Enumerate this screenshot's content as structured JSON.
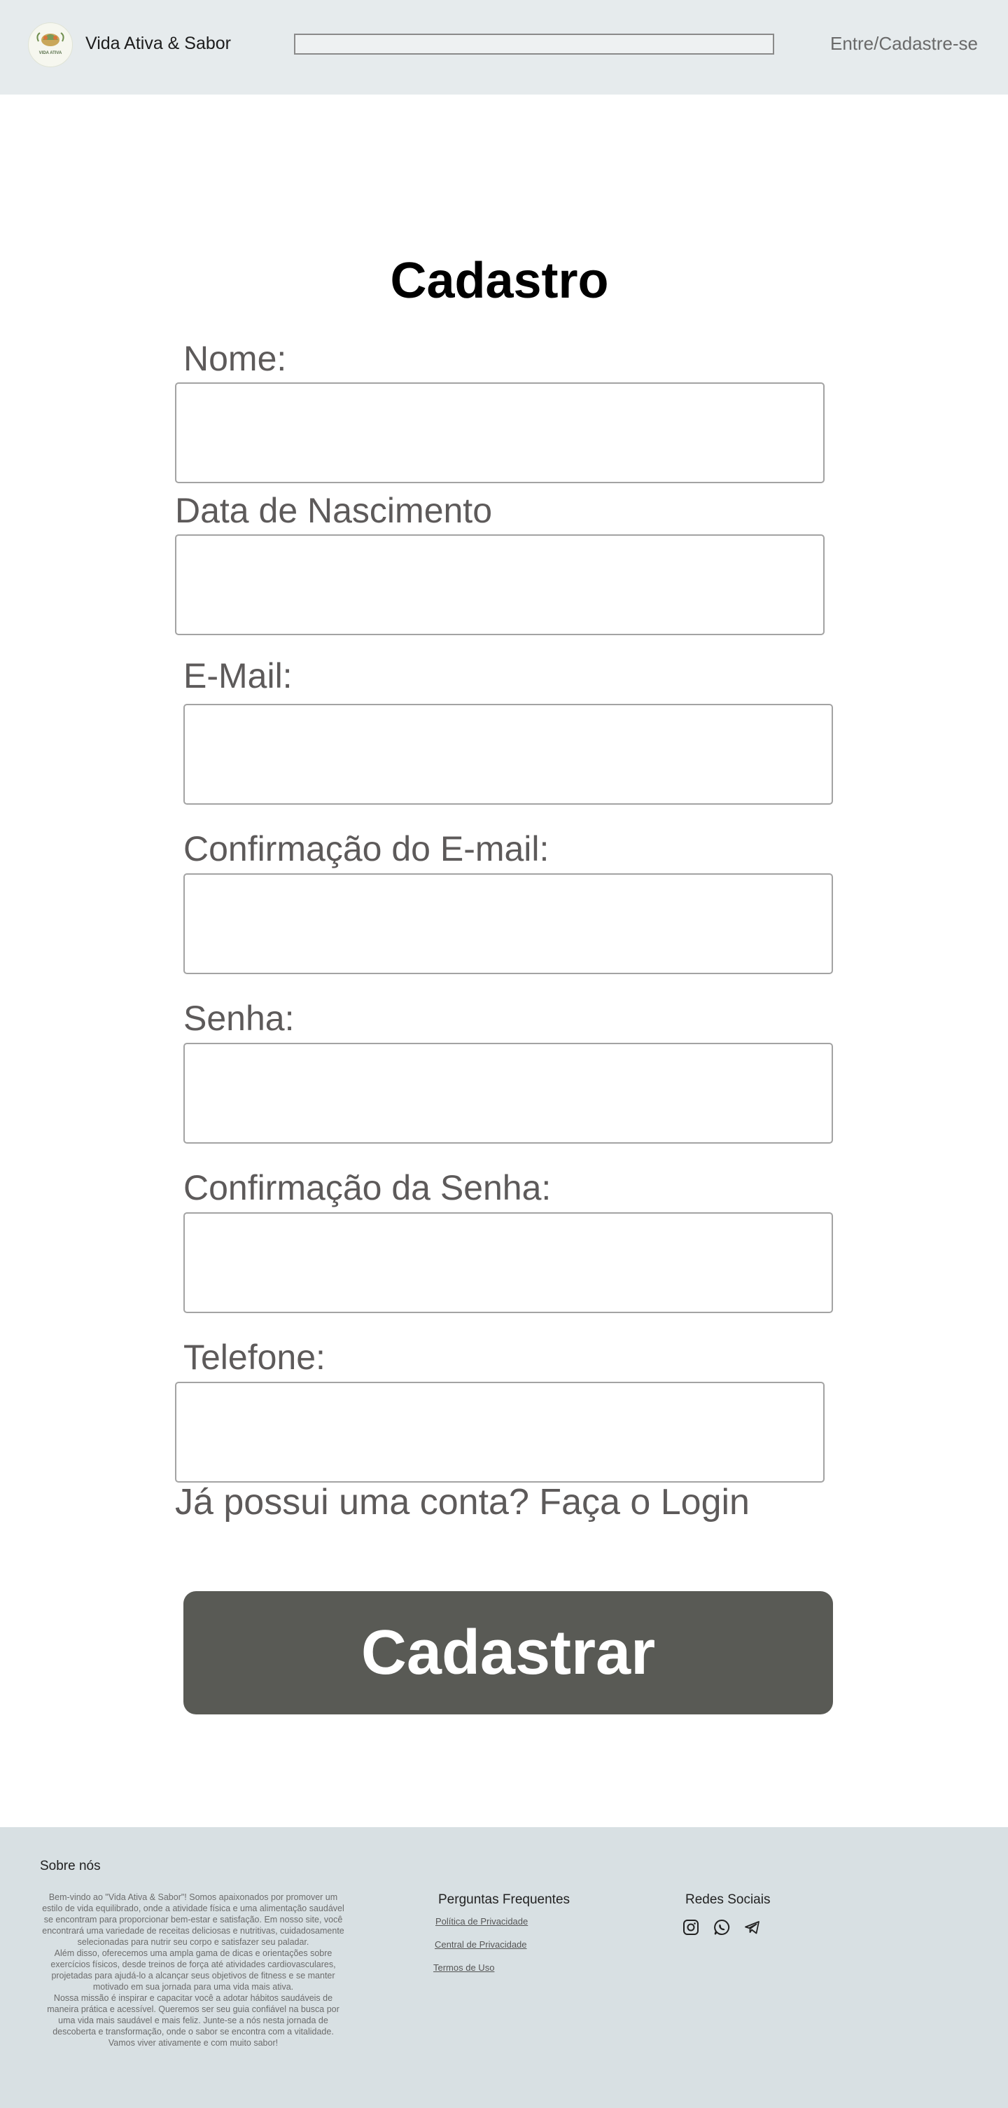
{
  "header": {
    "brand_name": "Vida Ativa & Sabor",
    "logo_text": "VIDA ATIVA",
    "search_value": "",
    "login_link": "Entre/Cadastre-se"
  },
  "form": {
    "title": "Cadastro",
    "fields": [
      {
        "label": "Nome:",
        "value": ""
      },
      {
        "label": "Data de Nascimento",
        "value": ""
      },
      {
        "label": "E-Mail:",
        "value": ""
      },
      {
        "label": "Confirmação do E-mail:",
        "value": ""
      },
      {
        "label": "Senha:",
        "value": ""
      },
      {
        "label": "Confirmação da Senha:",
        "value": ""
      },
      {
        "label": "Telefone:",
        "value": ""
      }
    ],
    "signin_text": "Já possui uma conta? Faça o Login",
    "submit_label": "Cadastrar"
  },
  "footer": {
    "about_title": "Sobre nós",
    "about_paragraphs": [
      "Bem-vindo ao \"Vida Ativa & Sabor\"! Somos apaixonados por promover um estilo de vida equilibrado, onde a atividade física e uma alimentação saudável se encontram para proporcionar bem-estar e satisfação. Em nosso site, você encontrará uma variedade de receitas deliciosas e nutritivas, cuidadosamente selecionadas para nutrir seu corpo e satisfazer seu paladar.",
      "Além disso, oferecemos uma ampla gama de dicas e orientações sobre exercícios físicos, desde treinos de força até atividades cardiovasculares, projetadas para ajudá-lo a alcançar seus objetivos de fitness e se manter motivado em sua jornada para uma vida mais ativa.",
      "Nossa missão é inspirar e capacitar você a adotar hábitos saudáveis de maneira prática e acessível. Queremos ser seu guia confiável na busca por uma vida mais saudável e mais feliz. Junte-se a nós nesta jornada de descoberta e transformação, onde o sabor se encontra com a vitalidade. Vamos viver ativamente e com muito sabor!"
    ],
    "faq_title": "Perguntas Frequentes",
    "links": [
      "Política de Privacidade",
      "Central de Privacidade",
      "Termos de Uso"
    ],
    "social_title": "Redes Sociais",
    "social_icons": [
      "instagram-icon",
      "whatsapp-icon",
      "telegram-icon"
    ]
  }
}
